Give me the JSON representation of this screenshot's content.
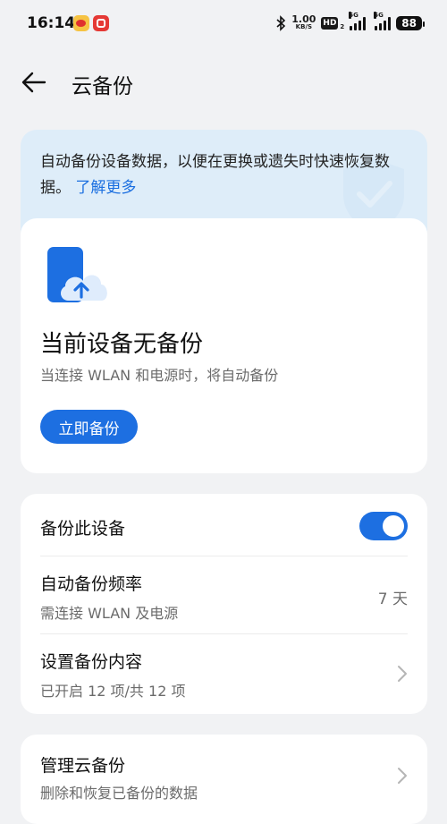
{
  "status_bar": {
    "time": "16:14",
    "speed_value": "1.00",
    "speed_unit": "KB/S",
    "hd_label": "HD",
    "hd_sub": "2",
    "network_1": "5G",
    "network_2": "5G",
    "battery": "88"
  },
  "header": {
    "title": "云备份"
  },
  "info_banner": {
    "text": "自动备份设备数据，以便在更换或遗失时快速恢复数据。",
    "link": "了解更多"
  },
  "backup_card": {
    "title": "当前设备无备份",
    "subtitle": "当连接 WLAN 和电源时，将自动备份",
    "button": "立即备份"
  },
  "settings": {
    "backup_device": {
      "label": "备份此设备",
      "enabled": true
    },
    "frequency": {
      "label": "自动备份频率",
      "sub": "需连接 WLAN 及电源",
      "value": "7 天"
    },
    "content": {
      "label": "设置备份内容",
      "sub": "已开启 12 项/共 12 项"
    }
  },
  "manage": {
    "label": "管理云备份",
    "sub": "删除和恢复已备份的数据"
  },
  "colors": {
    "accent": "#1d6fe1",
    "link": "#1b6fe0",
    "banner_bg": "#deedf9",
    "page_bg": "#f1f2f4"
  }
}
